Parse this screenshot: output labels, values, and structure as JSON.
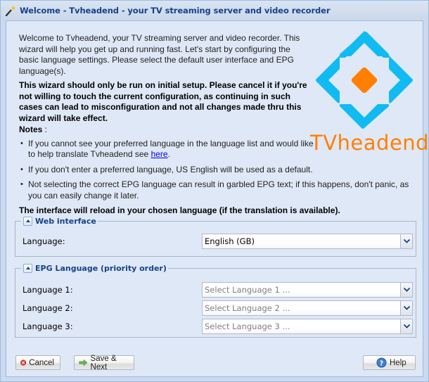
{
  "window": {
    "title": "Welcome - Tvheadend - your TV streaming server and video recorder",
    "title_icon": "wizard-wand-icon"
  },
  "intro": {
    "paragraph1": "Welcome to Tvheadend, your TV streaming server and video recorder. This wizard will help you get up and running fast. Let's start by configuring the basic language settings. Please select the default user interface and EPG language(s).",
    "warning": "This wizard should only be run on initial setup. Please cancel it if you're not willing to touch the current configuration, as continuing in such cases can lead to misconfiguration and not all changes made thru this wizard will take effect.",
    "notes_label": "Notes",
    "notes_suffix": " :",
    "notes": [
      {
        "text": "If you cannot see your preferred language in the language list and would like to help translate Tvheadend see ",
        "link": "here",
        "after": "."
      },
      {
        "text": "If you don't enter a preferred language, US English will be used as a default."
      },
      {
        "text": "Not selecting the correct EPG language can result in garbled EPG text; if this happens, don't panic, as you can easily change it later."
      }
    ],
    "reload_notice": "The interface will reload in your chosen language (if the translation is available)."
  },
  "logo": {
    "text": "TVheadend",
    "colors": {
      "blue": "#11bbf2",
      "orange": "#ff8000"
    }
  },
  "web_interface": {
    "title": "Web interface",
    "language_label": "Language:",
    "language_value": "English (GB)"
  },
  "epg_language": {
    "title": "EPG Language (priority order)",
    "rows": [
      {
        "label": "Language 1:",
        "placeholder": "Select Language 1 ..."
      },
      {
        "label": "Language 2:",
        "placeholder": "Select Language 2 ..."
      },
      {
        "label": "Language 3:",
        "placeholder": "Select Language 3 ..."
      }
    ]
  },
  "buttons": {
    "cancel": "Cancel",
    "save_next": "Save & Next",
    "help": "Help"
  },
  "colors": {
    "title_text": "#15428b",
    "body_bg": "#dfe8f6",
    "link": "#0000ee"
  }
}
